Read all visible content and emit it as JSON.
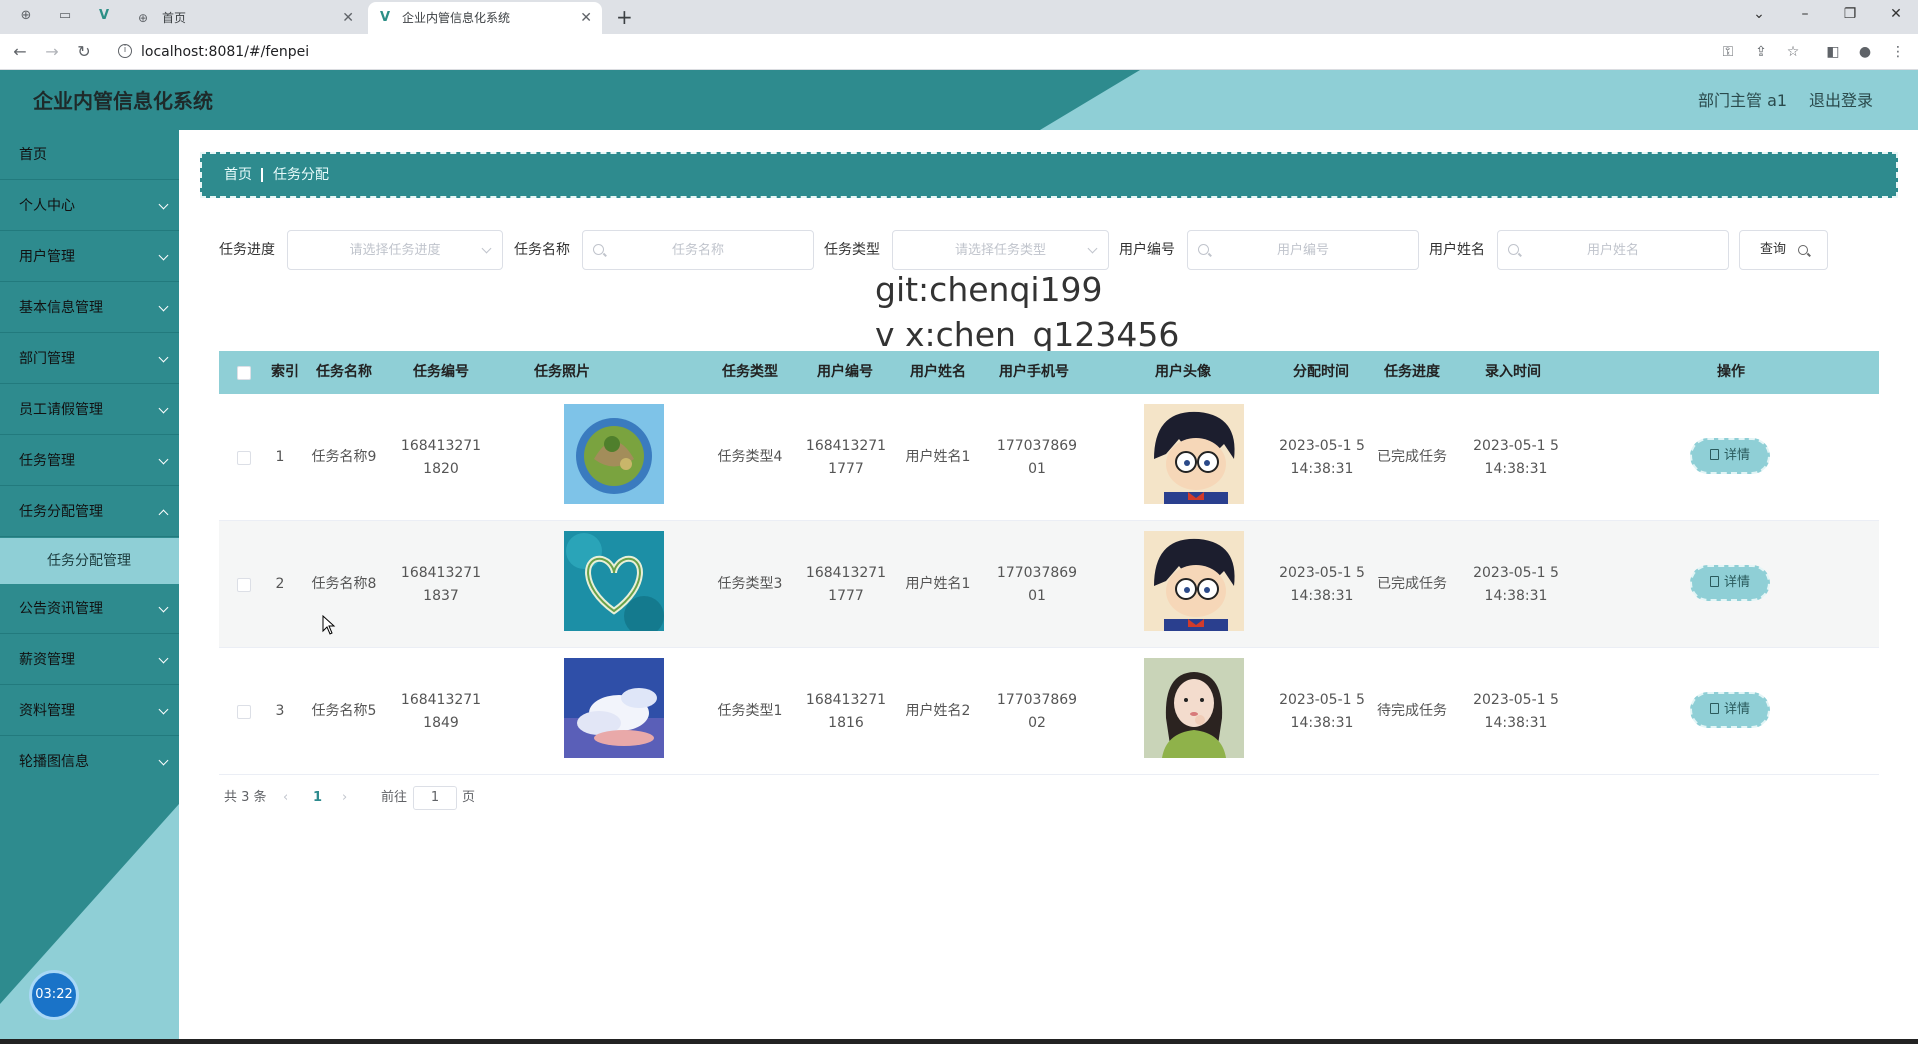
{
  "browser": {
    "tabs": [
      {
        "label": "首页",
        "active": false
      },
      {
        "label": "企业内管信息化系统",
        "active": true
      }
    ],
    "url": "localhost:8081/#/fenpei"
  },
  "header": {
    "title": "企业内管信息化系统",
    "user": "部门主管 a1",
    "logout": "退出登录"
  },
  "sidebar": {
    "items": [
      {
        "label": "首页",
        "has_children": false
      },
      {
        "label": "个人中心",
        "has_children": true
      },
      {
        "label": "用户管理",
        "has_children": true
      },
      {
        "label": "基本信息管理",
        "has_children": true
      },
      {
        "label": "部门管理",
        "has_children": true
      },
      {
        "label": "员工请假管理",
        "has_children": true
      },
      {
        "label": "任务管理",
        "has_children": true
      },
      {
        "label": "任务分配管理",
        "has_children": true,
        "expanded": true
      },
      {
        "label": "公告资讯管理",
        "has_children": true
      },
      {
        "label": "薪资管理",
        "has_children": true
      },
      {
        "label": "资料管理",
        "has_children": true
      },
      {
        "label": "轮播图信息",
        "has_children": true
      }
    ],
    "submenu_active": "任务分配管理",
    "timer": "03:22"
  },
  "breadcrumb": {
    "home": "首页",
    "current": "任务分配"
  },
  "filters": {
    "progress": {
      "label": "任务进度",
      "placeholder": "请选择任务进度"
    },
    "name": {
      "label": "任务名称",
      "placeholder": "任务名称"
    },
    "type": {
      "label": "任务类型",
      "placeholder": "请选择任务类型"
    },
    "user_no": {
      "label": "用户编号",
      "placeholder": "用户编号"
    },
    "user_name": {
      "label": "用户姓名",
      "placeholder": "用户姓名"
    },
    "query_button": "查询"
  },
  "watermark": [
    "git:chenqi199",
    "v x:chen_q123456"
  ],
  "table": {
    "columns": [
      "索引",
      "任务名称",
      "任务编号",
      "任务照片",
      "任务类型",
      "用户编号",
      "用户姓名",
      "用户手机号",
      "用户头像",
      "分配时间",
      "任务进度",
      "录入时间",
      "操作"
    ],
    "rows": [
      {
        "index": "1",
        "task_name": "任务名称9",
        "task_no": "168413271 1820",
        "task_type": "任务类型4",
        "user_no": "168413271 1777",
        "user_name": "用户姓名1",
        "phone": "177037869 01",
        "assign_time": "2023-05-1 5 14:38:31",
        "progress": "已完成任务",
        "entry_time": "2023-05-1 5 14:38:31",
        "photo": "planet-island-photo",
        "avatar": "cartoon-boy-avatar",
        "action": "详情"
      },
      {
        "index": "2",
        "task_name": "任务名称8",
        "task_no": "168413271 1837",
        "task_type": "任务类型3",
        "user_no": "168413271 1777",
        "user_name": "用户姓名1",
        "phone": "177037869 01",
        "assign_time": "2023-05-1 5 14:38:31",
        "progress": "已完成任务",
        "entry_time": "2023-05-1 5 14:38:31",
        "photo": "heart-island-photo",
        "avatar": "cartoon-boy-avatar",
        "action": "详情"
      },
      {
        "index": "3",
        "task_name": "任务名称5",
        "task_no": "168413271 1849",
        "task_type": "任务类型1",
        "user_no": "168413271 1816",
        "user_name": "用户姓名2",
        "phone": "177037869 02",
        "assign_time": "2023-05-1 5 14:38:31",
        "progress": "待完成任务",
        "entry_time": "2023-05-1 5 14:38:31",
        "photo": "sky-clouds-photo",
        "avatar": "girl-portrait-avatar",
        "action": "详情"
      }
    ]
  },
  "pagination": {
    "total": "共 3 条",
    "current_page": "1",
    "goto_prefix": "前往",
    "goto_value": "1",
    "goto_suffix": "页"
  },
  "colors": {
    "primary": "#2e8b8e",
    "light": "#8fcfd6"
  }
}
